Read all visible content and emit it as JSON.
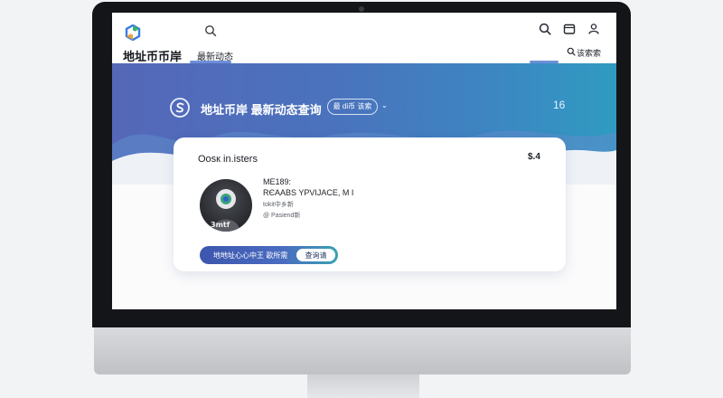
{
  "navbar": {
    "brand": "地址币币岸",
    "nav_link": "最新动态",
    "search_label": "该索索",
    "icons": [
      "search-icon",
      "wallet-icon",
      "user-icon"
    ]
  },
  "hero": {
    "title": "地址币岸 最新动态查询",
    "pill_label": "最 di币 该索",
    "chevron": "⌄",
    "number": "16"
  },
  "card": {
    "title": "Oosк in.isters",
    "amount": "$.4",
    "info": {
      "line1": "ME189:",
      "line2": "RЄAABS YPVIJACE, M  I",
      "line3": "tokit中乡新",
      "line4": "@ Pasiend新"
    },
    "avatar_tag": "3mtf",
    "action_label": "地地址心心中王 歌所需",
    "query_button": "查询请"
  },
  "colors": {
    "hero_start": "#5567b8",
    "hero_end": "#2f9bc1",
    "accent": "#4a6cc0"
  }
}
